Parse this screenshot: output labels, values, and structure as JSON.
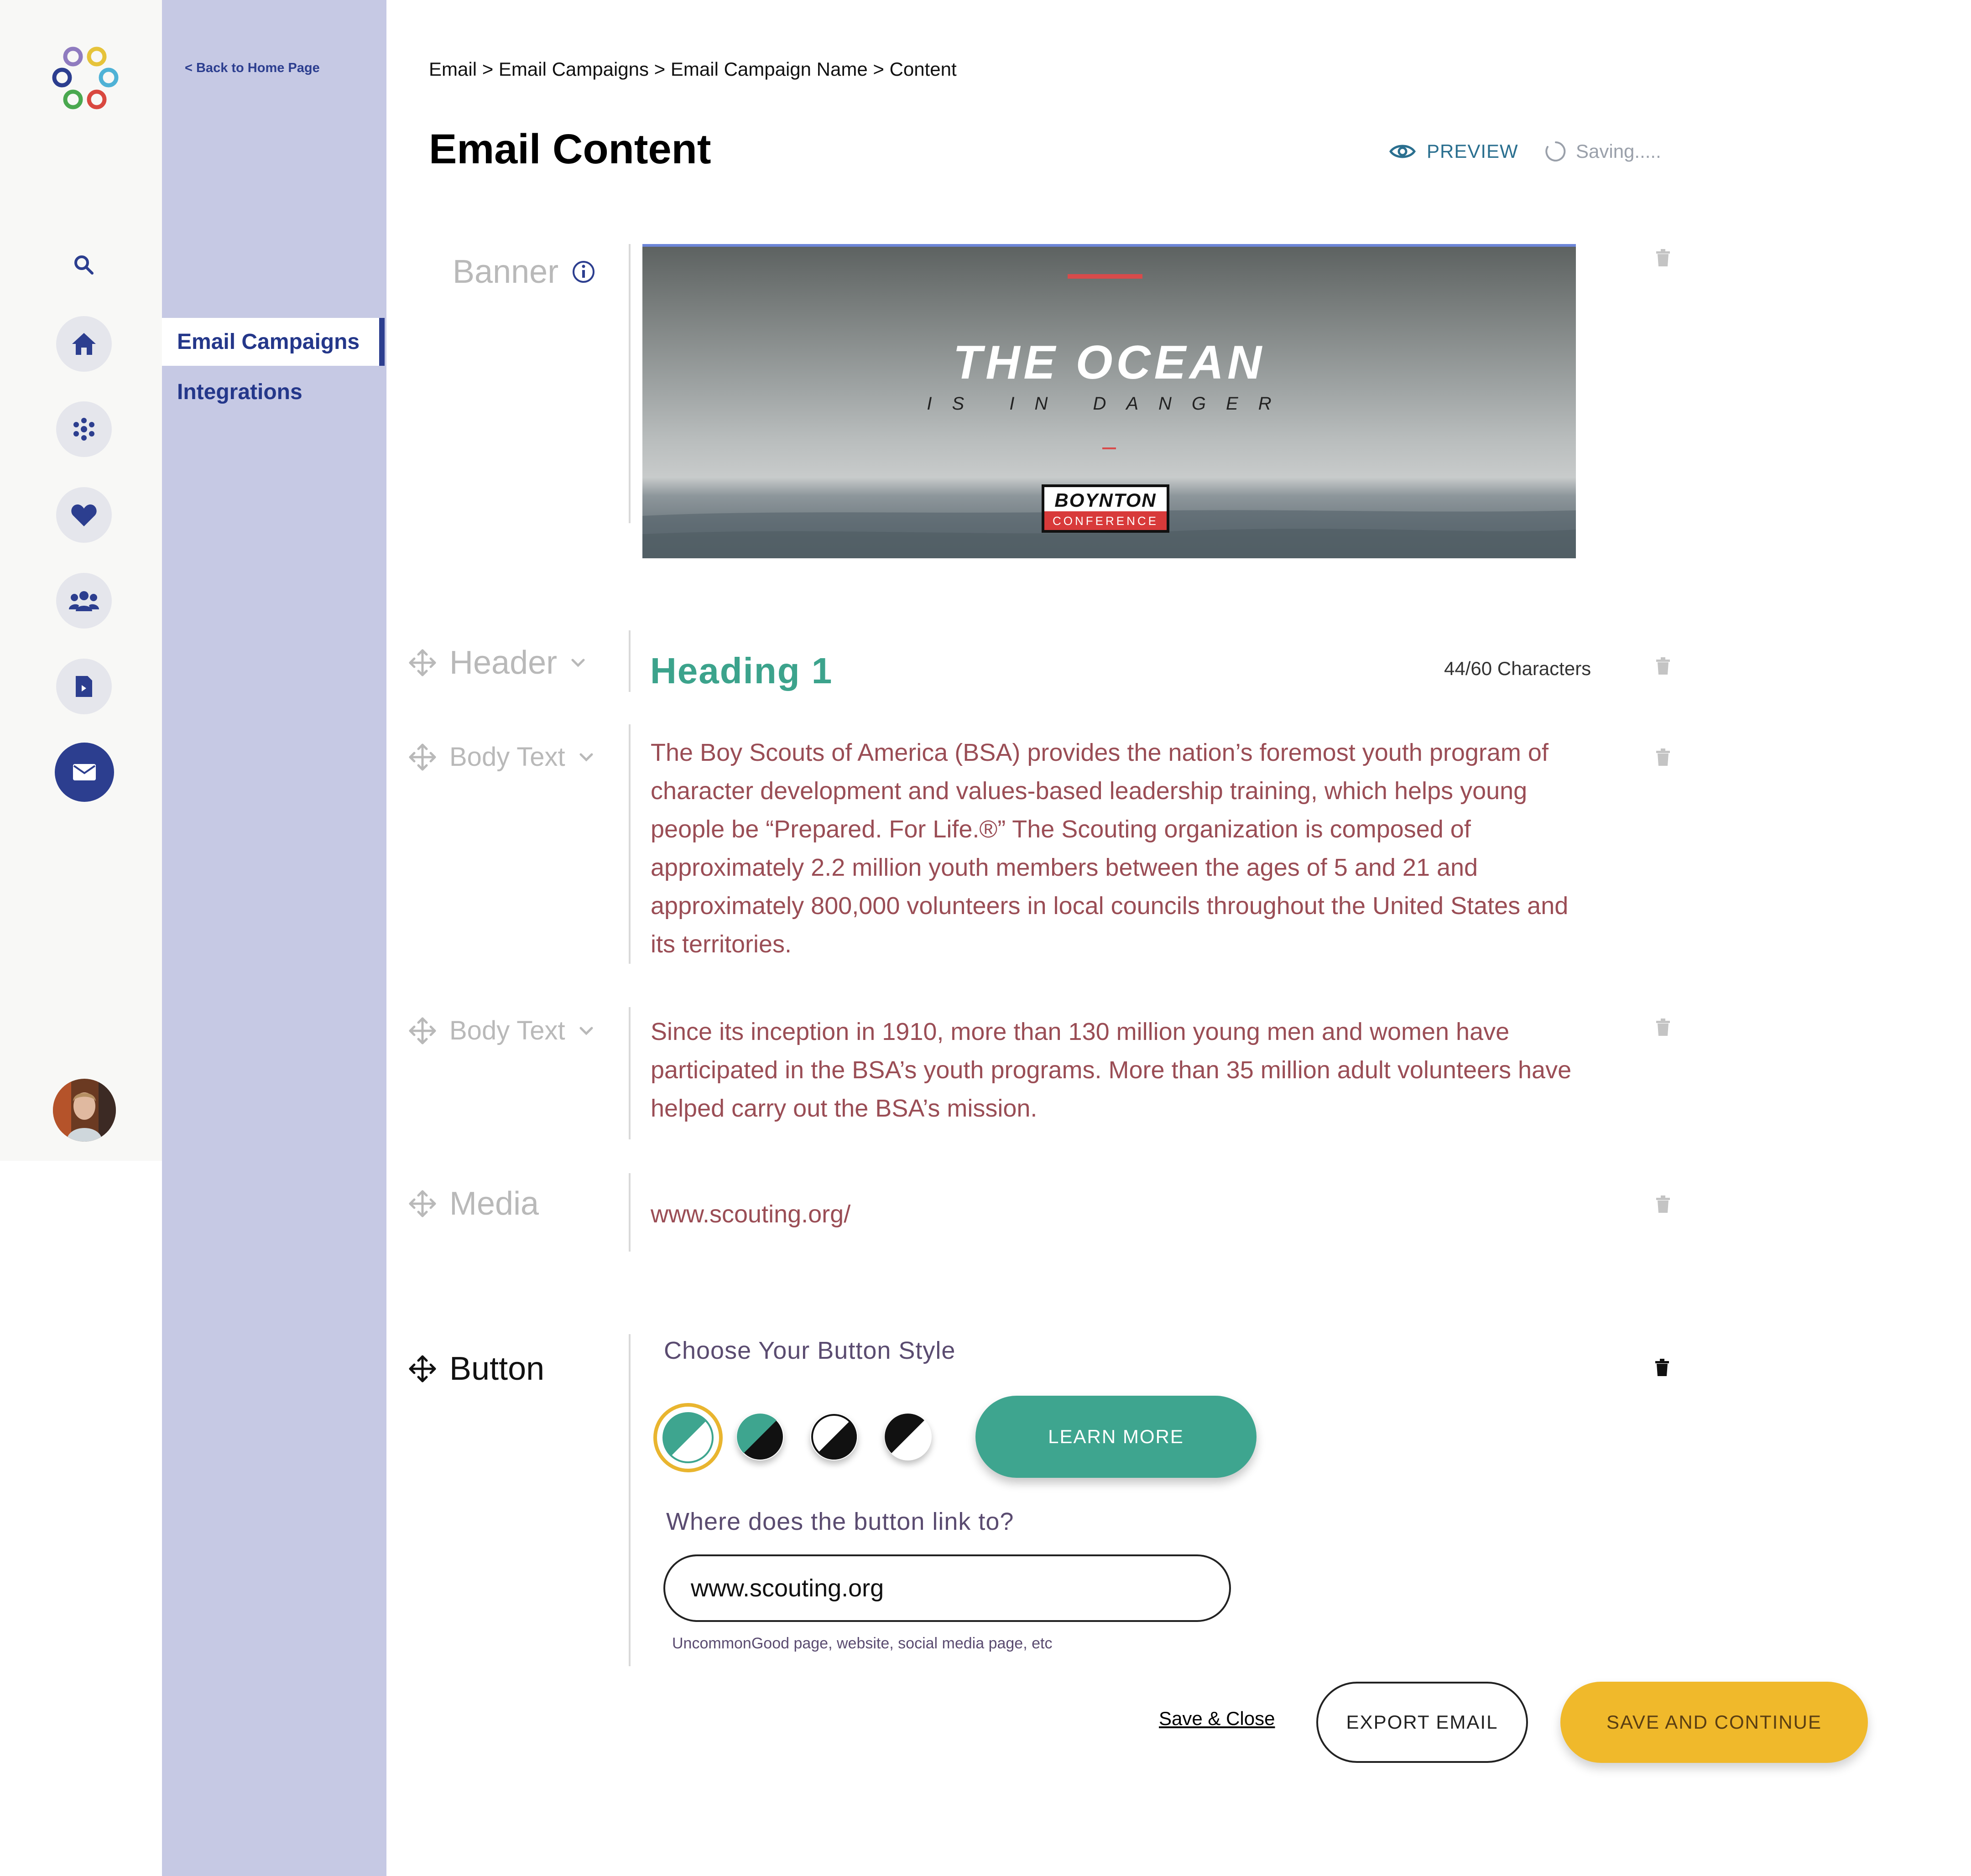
{
  "nav": {
    "back_label": "< Back to Home Page",
    "items": [
      {
        "label": "Email Campaigns",
        "active": true
      },
      {
        "label": "Integrations",
        "active": false
      }
    ],
    "rail_icons": [
      "search-icon",
      "home-icon",
      "network-icon",
      "heart-icon",
      "people-icon",
      "document-icon",
      "mail-icon"
    ]
  },
  "header": {
    "breadcrumb": "Email > Email Campaigns > Email Campaign Name > Content",
    "title": "Email Content",
    "preview_label": "PREVIEW",
    "saving_label": "Saving....."
  },
  "blocks": {
    "banner": {
      "label": "Banner",
      "image_title": "THE OCEAN",
      "image_subtitle": "IS IN DANGER",
      "logo_top": "BOYNTON",
      "logo_bottom": "CONFERENCE"
    },
    "header": {
      "label": "Header",
      "value": "Heading 1",
      "char_count": "44/60 Characters"
    },
    "body1": {
      "label": "Body Text",
      "text": "The Boy Scouts of America (BSA) provides the nation’s foremost youth program of character development and values-based leadership training, which helps young people be “Prepared. For Life.®” The Scouting organization is composed of approximately 2.2 million youth members between the ages of 5 and 21 and approximately 800,000 volunteers in local councils throughout the United States and its territories."
    },
    "body2": {
      "label": "Body Text",
      "text": "Since its inception in 1910, more than 130 million young men and women have participated in the BSA’s youth programs. More than 35 million adult volunteers have helped carry out the BSA’s mission."
    },
    "media": {
      "label": "Media",
      "url": "www.scouting.org/"
    },
    "button": {
      "label": "Button",
      "choose_title": "Choose Your Button Style",
      "preview_label": "LEARN MORE",
      "link_question": "Where does the button link to?",
      "link_value": "www.scouting.org",
      "link_hint": "UncommonGood page, website, social media page, etc"
    }
  },
  "footer": {
    "save_close": "Save & Close",
    "export": "EXPORT EMAIL",
    "save_continue": "SAVE AND CONTINUE"
  },
  "colors": {
    "primary": "#2c3e8f",
    "teal": "#3ea58f",
    "body_text": "#9a4d55",
    "accent_yellow": "#f0b92b",
    "subnav_bg": "#c6c9e4"
  }
}
